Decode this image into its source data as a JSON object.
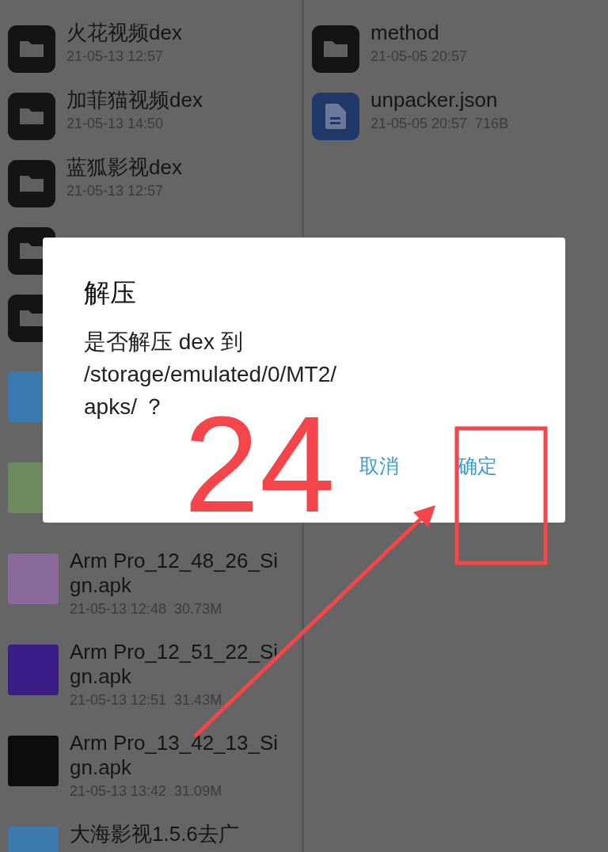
{
  "left_pane": {
    "rows": [
      {
        "kind": "folder",
        "name": "火花视频dex",
        "meta": "21-05-13 12:57"
      },
      {
        "kind": "folder",
        "name": "加菲猫视频dex",
        "meta": "21-05-13 14:50"
      },
      {
        "kind": "folder",
        "name": "蓝狐影视dex",
        "meta": "21-05-13 12:57"
      },
      {
        "kind": "folder"
      },
      {
        "kind": "folder"
      },
      {
        "kind": "apk"
      },
      {
        "kind": "apk"
      },
      {
        "kind": "apk",
        "name": "Arm Pro_12_48_26_Sign.apk",
        "meta": "21-05-13 12:48  30.73M"
      },
      {
        "kind": "apk",
        "name": "Arm Pro_12_51_22_Sign.apk",
        "meta": "21-05-13 12:51  31.43M"
      },
      {
        "kind": "apk",
        "name": "Arm Pro_13_42_13_Sign.apk",
        "meta": "21-05-13 13:42  31.09M"
      },
      {
        "kind": "apk",
        "name": "大海影视1.5.6去广"
      }
    ]
  },
  "right_pane": {
    "rows": [
      {
        "kind": "folder",
        "name": "method",
        "meta": "21-05-05 20:57"
      },
      {
        "kind": "file",
        "name": "unpacker.json",
        "meta": "21-05-05 20:57  716B"
      }
    ]
  },
  "dialog": {
    "title": "解压",
    "message_lines": [
      "是否解压 dex 到",
      "/storage/emulated/0/MT2/",
      "apks/ ？"
    ],
    "buttons": [
      "取消",
      "确定"
    ]
  },
  "annotation": {
    "number": "24"
  }
}
